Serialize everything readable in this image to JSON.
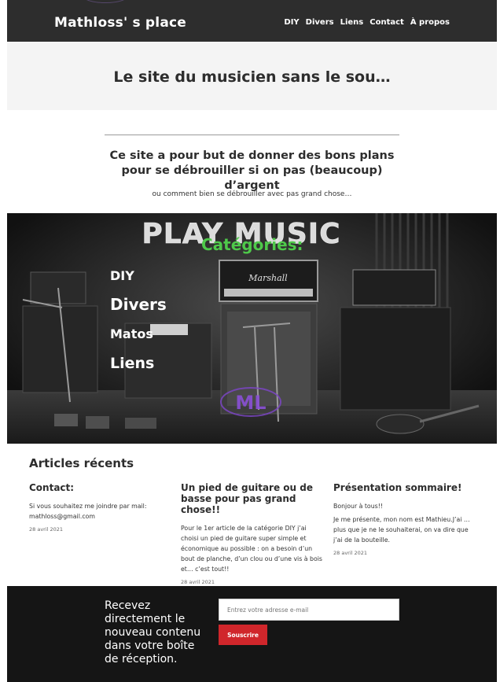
{
  "header": {
    "site_title": "Mathloss' s place",
    "nav": [
      "DIY",
      "Divers",
      "Liens",
      "Contact",
      "À propos"
    ]
  },
  "hero": {
    "title": "Le site du musicien sans le sou…"
  },
  "intro": {
    "heading": "Ce site a pour but de donner des bons plans pour se débrouiller si on pas (beaucoup) d’argent",
    "subtext": "ou comment bien se débrouiller avec pas grand chose…"
  },
  "banner": {
    "background_text": "PLAY MUSIC",
    "heading": "Catégories:",
    "categories": [
      "DIY",
      "Divers",
      "Matos",
      "Liens"
    ],
    "logo_text": "ML",
    "amp_brand": "Marshall",
    "heading_color": "#4ec94a",
    "logo_color": "#7a45c2"
  },
  "recent": {
    "title": "Articles récents",
    "posts": [
      {
        "title": "Contact:",
        "excerpt": [
          "Si vous souhaitez me joindre par mail: mathloss@gmail.com"
        ],
        "date": "28 avril 2021"
      },
      {
        "title": "Un pied de guitare ou de basse pour pas grand chose!!",
        "excerpt": [
          "Pour le 1er article de la catégorie DIY j’ai choisi un pied de guitare super simple et économique au possible : on a besoin d’un bout de planche, d’un clou ou d’une vis à bois et… c’est tout!!"
        ],
        "date": "28 avril 2021"
      },
      {
        "title": "Présentation sommaire!",
        "excerpt": [
          "Bonjour à tous!!",
          "Je me présente, mon nom est Mathieu.J’ai … plus que je ne le souhaiterai, on va dire que j’ai de la bouteille."
        ],
        "date": "28 avril 2021"
      }
    ]
  },
  "newsletter": {
    "text": "Recevez directement le nouveau contenu dans votre boîte de réception.",
    "placeholder": "Entrez votre adresse e-mail",
    "button": "Souscrire",
    "button_color": "#d0262b"
  }
}
